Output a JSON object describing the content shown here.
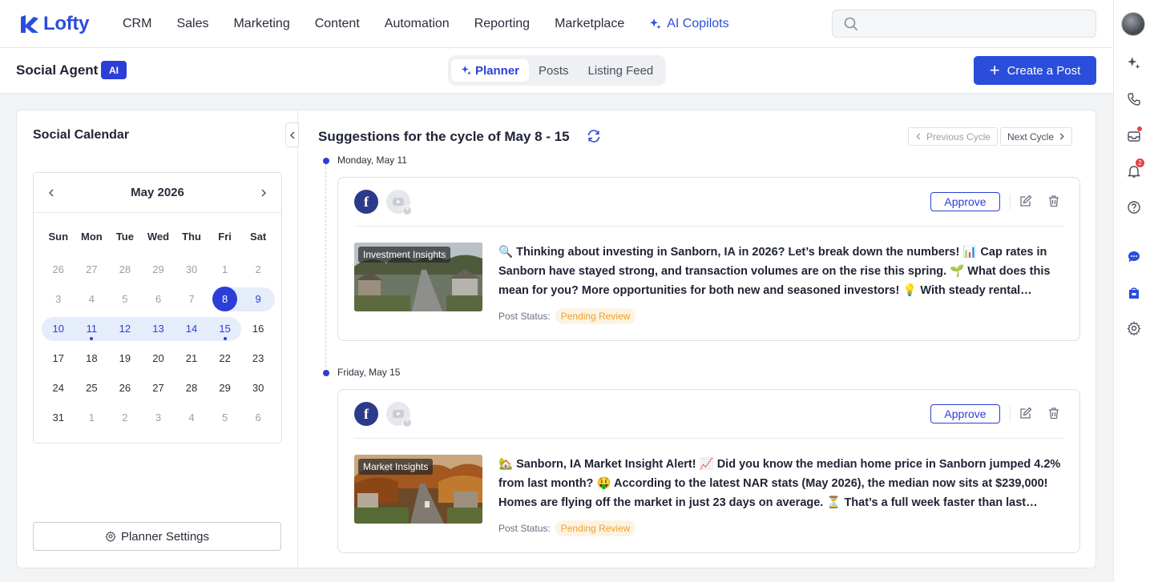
{
  "nav": {
    "brand": "Lofty",
    "items": [
      "CRM",
      "Sales",
      "Marketing",
      "Content",
      "Automation",
      "Reporting",
      "Marketplace"
    ],
    "ai_item": "AI Copilots",
    "search_placeholder": ""
  },
  "rail": {
    "notification_count": "2",
    "icons": [
      "ai-sparkle-icon",
      "phone-icon",
      "inbox-icon",
      "bell-icon",
      "help-icon",
      "chat-icon",
      "store-icon",
      "gear-icon"
    ]
  },
  "subheader": {
    "title": "Social Agent",
    "badge": "AI",
    "tabs": [
      "Planner",
      "Posts",
      "Listing Feed"
    ],
    "active_tab": "Planner",
    "create_button": "Create a Post"
  },
  "calendar": {
    "title": "Social Calendar",
    "month_label": "May 2026",
    "weekdays": [
      "Sun",
      "Mon",
      "Tue",
      "Wed",
      "Thu",
      "Fri",
      "Sat"
    ],
    "weeks": [
      [
        [
          "26",
          "muted"
        ],
        [
          "27",
          "muted"
        ],
        [
          "28",
          "muted"
        ],
        [
          "29",
          "muted"
        ],
        [
          "30",
          "muted"
        ],
        [
          "1",
          "muted"
        ],
        [
          "2",
          "muted"
        ]
      ],
      [
        [
          "3",
          "muted"
        ],
        [
          "4",
          "muted"
        ],
        [
          "5",
          "muted"
        ],
        [
          "6",
          "muted"
        ],
        [
          "7",
          "muted"
        ],
        [
          "8",
          "selected"
        ],
        [
          "9",
          "range-last"
        ]
      ],
      [
        [
          "10",
          "range-first"
        ],
        [
          "11",
          "range-dot"
        ],
        [
          "12",
          "range"
        ],
        [
          "13",
          "range"
        ],
        [
          "14",
          "range"
        ],
        [
          "15",
          "range-last-dot"
        ],
        [
          "16",
          ""
        ]
      ],
      [
        [
          "17",
          ""
        ],
        [
          "18",
          ""
        ],
        [
          "19",
          ""
        ],
        [
          "20",
          ""
        ],
        [
          "21",
          ""
        ],
        [
          "22",
          ""
        ],
        [
          "23",
          ""
        ]
      ],
      [
        [
          "24",
          ""
        ],
        [
          "25",
          ""
        ],
        [
          "26",
          ""
        ],
        [
          "27",
          ""
        ],
        [
          "28",
          ""
        ],
        [
          "29",
          ""
        ],
        [
          "30",
          ""
        ]
      ],
      [
        [
          "31",
          ""
        ],
        [
          "1",
          "muted"
        ],
        [
          "2",
          "muted"
        ],
        [
          "3",
          "muted"
        ],
        [
          "4",
          "muted"
        ],
        [
          "5",
          "muted"
        ],
        [
          "6",
          "muted"
        ]
      ]
    ],
    "settings_button": "Planner Settings"
  },
  "suggestions": {
    "title": "Suggestions for the cycle of May 8 - 15",
    "prev_cycle": "Previous Cycle",
    "next_cycle": "Next Cycle",
    "status_label": "Post Status:",
    "approve_label": "Approve",
    "posts": [
      {
        "date": "Monday, May 11",
        "thumb_tag": "Investment Insights",
        "text": "🔍 Thinking about investing in Sanborn, IA in 2026? Let’s break down the numbers! 📊 Cap rates in Sanborn have stayed strong, and transaction volumes are on the rise this spring. 🌱 What does this mean for you? More opportunities for both new and seasoned investors! 💡 With steady rental…",
        "status": "Pending Review"
      },
      {
        "date": "Friday, May 15",
        "thumb_tag": "Market Insights",
        "text": "🏡 Sanborn, IA Market Insight Alert! 📈 Did you know the median home price in Sanborn jumped 4.2% from last month? 🤑 According to the latest NAR stats (May 2026), the median now sits at $239,000! Homes are flying off the market in just 23 days on average. ⏳ That’s a full week faster than last…",
        "status": "Pending Review"
      }
    ]
  },
  "colors": {
    "accent": "#2b4ddb",
    "status_pending": "#f0a02b"
  }
}
